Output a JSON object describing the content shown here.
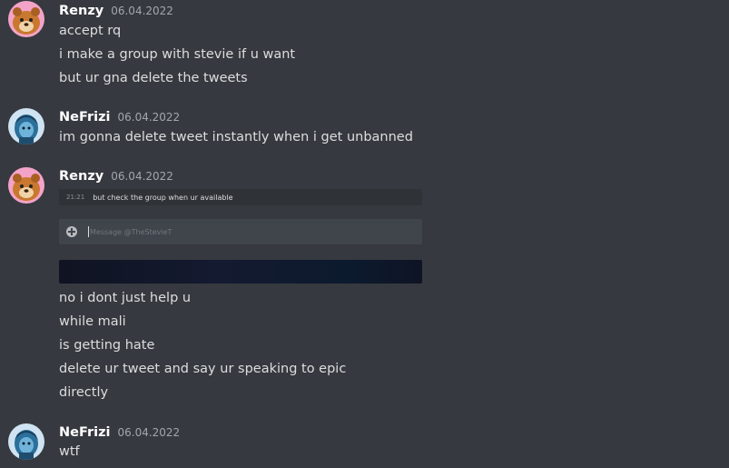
{
  "colors": {
    "background": "#36393f",
    "username": "#ffffff",
    "timestamp": "#a3a6aa",
    "message_text": "#dcddde"
  },
  "messages": [
    {
      "author": "Renzy",
      "timestamp": "06.04.2022",
      "avatar_icon": "orange-bear-avatar",
      "lines": [
        "accept rq",
        "i make a group with stevie if u want",
        "but ur gna delete the tweets"
      ]
    },
    {
      "author": "NeFrizi",
      "timestamp": "06.04.2022",
      "avatar_icon": "blue-character-avatar",
      "lines": [
        "im gonna delete tweet instantly when i get unbanned"
      ]
    },
    {
      "author": "Renzy",
      "timestamp": "06.04.2022",
      "avatar_icon": "orange-bear-avatar",
      "embedded_screenshot": {
        "time": "21:21",
        "text": "but check the group when ur available",
        "input_placeholder": "Message @TheStevieT",
        "input_icon": "plus-circle-icon"
      },
      "lines": [
        "no i dont just help u",
        "while mali",
        "is getting hate",
        "delete ur tweet and say ur speaking to epic",
        "directly"
      ]
    },
    {
      "author": "NeFrizi",
      "timestamp": "06.04.2022",
      "avatar_icon": "blue-character-avatar",
      "lines": [
        "wtf"
      ]
    }
  ]
}
